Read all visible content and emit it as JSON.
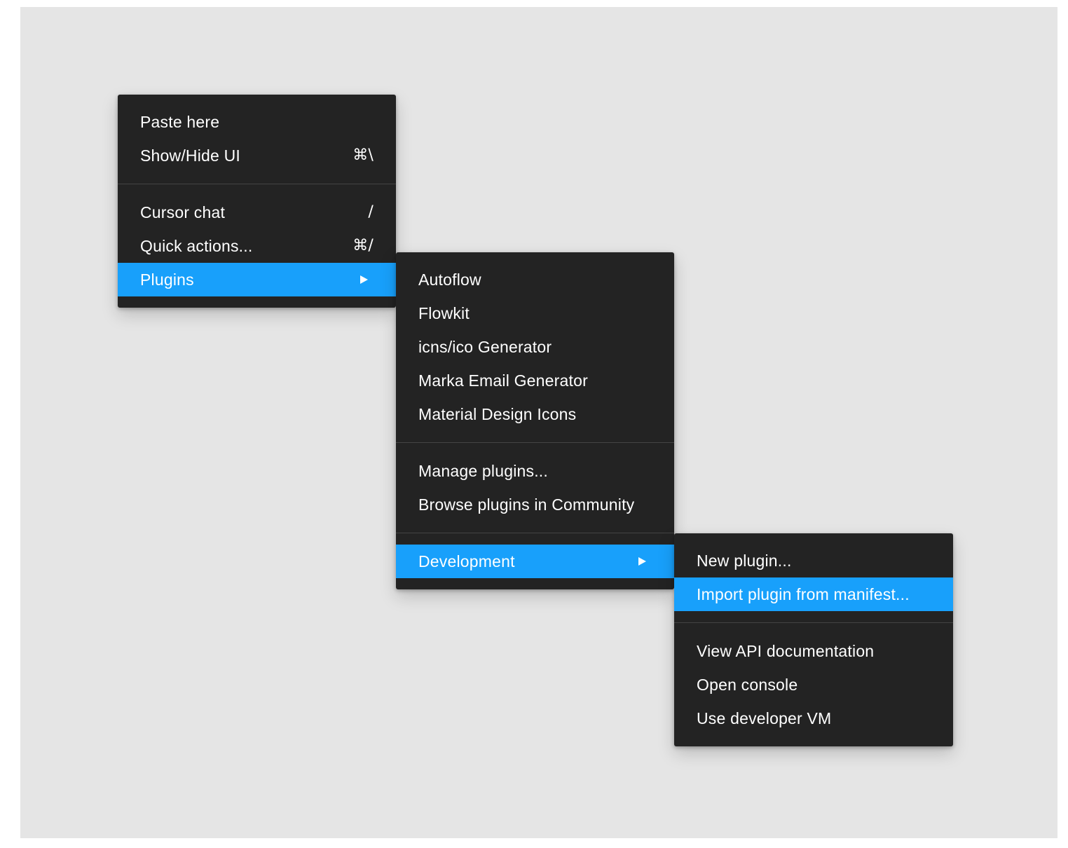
{
  "colors": {
    "canvas_background": "#e5e5e5",
    "menu_background": "#232323",
    "highlight": "#18a0fb",
    "separator": "#444444",
    "text": "#ffffff"
  },
  "main_menu": {
    "items": [
      {
        "label": "Paste here",
        "shortcut": ""
      },
      {
        "label": "Show/Hide UI",
        "shortcut": "⌘\\"
      },
      {
        "label": "Cursor chat",
        "shortcut": "/"
      },
      {
        "label": "Quick actions...",
        "shortcut": "⌘/"
      },
      {
        "label": "Plugins",
        "submenu_icon": "triangle-right-icon",
        "highlighted": true
      }
    ]
  },
  "plugins_menu": {
    "items": [
      {
        "label": "Autoflow"
      },
      {
        "label": "Flowkit"
      },
      {
        "label": "icns/ico Generator"
      },
      {
        "label": "Marka Email Generator"
      },
      {
        "label": "Material Design Icons"
      },
      {
        "label": "Manage plugins..."
      },
      {
        "label": "Browse plugins in Community"
      },
      {
        "label": "Development",
        "submenu_icon": "triangle-right-icon",
        "highlighted": true
      }
    ]
  },
  "development_menu": {
    "items": [
      {
        "label": "New plugin..."
      },
      {
        "label": "Import plugin from manifest...",
        "highlighted": true
      },
      {
        "label": "View API documentation"
      },
      {
        "label": "Open console"
      },
      {
        "label": "Use developer VM"
      }
    ]
  }
}
